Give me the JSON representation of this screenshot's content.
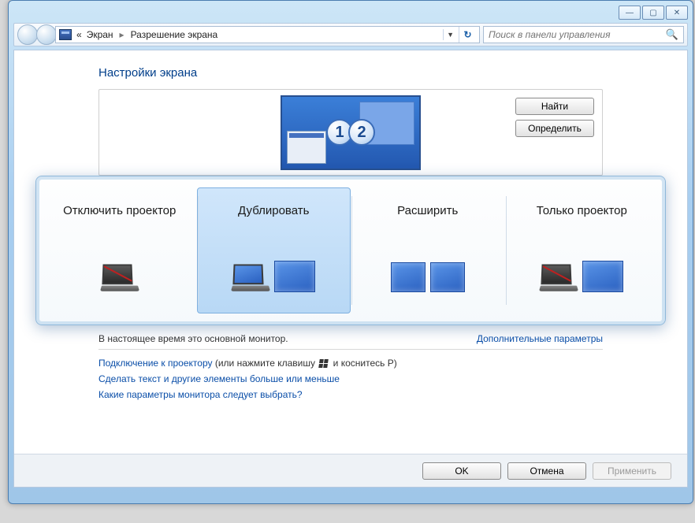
{
  "window": {
    "minimize": "—",
    "maximize": "▢",
    "close": "✕"
  },
  "breadcrumb": {
    "prefix": "«",
    "item1": "Экран",
    "item2": "Разрешение экрана"
  },
  "search": {
    "placeholder": "Поиск в панели управления"
  },
  "page": {
    "title": "Настройки экрана",
    "find_btn": "Найти",
    "detect_btn": "Определить",
    "monitor_num1": "1",
    "monitor_num2": "2",
    "primary_text": "В настоящее время это основной монитор.",
    "advanced_link": "Дополнительные параметры",
    "link_projector_a": "Подключение к проектору",
    "link_projector_b": " (или нажмите клавишу ",
    "link_projector_c": " и коснитесь P)",
    "link_text_size": "Сделать текст и другие элементы больше или меньше",
    "link_which": "Какие параметры монитора следует выбрать?",
    "ok": "OK",
    "cancel": "Отмена",
    "apply": "Применить"
  },
  "projector_options": [
    {
      "label": "Отключить проектор"
    },
    {
      "label": "Дублировать"
    },
    {
      "label": "Расширить"
    },
    {
      "label": "Только проектор"
    }
  ],
  "selected_option_index": 1
}
